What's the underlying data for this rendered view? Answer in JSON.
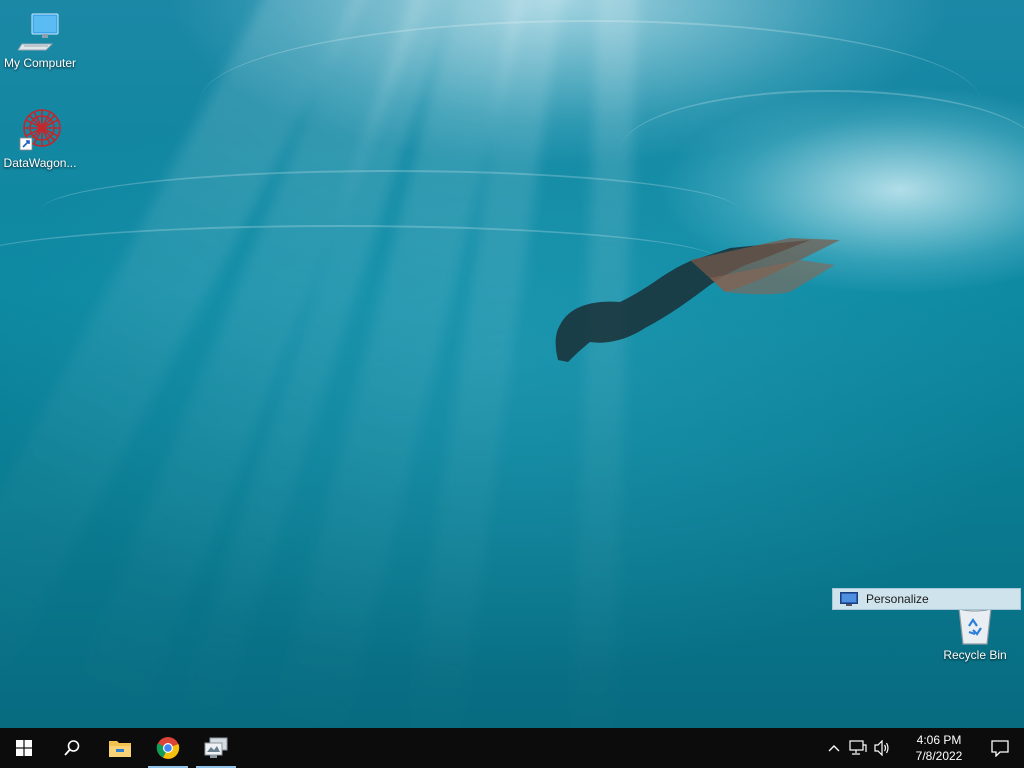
{
  "desktop": {
    "icons": [
      {
        "label": "My Computer",
        "icon": "computer-icon"
      },
      {
        "label": "DataWagon...",
        "icon": "datawagon-icon"
      },
      {
        "label": "Recycle Bin",
        "icon": "recycle-bin-icon"
      }
    ],
    "tooltip": {
      "label": "Personalize",
      "icon": "personalize-icon"
    }
  },
  "taskbar": {
    "pinned": [
      {
        "icon": "windows-start-icon"
      },
      {
        "icon": "search-icon"
      },
      {
        "icon": "file-explorer-icon"
      },
      {
        "icon": "chrome-icon"
      },
      {
        "icon": "remote-desktop-icon"
      }
    ],
    "tray": {
      "icons": [
        "chevron-up-icon",
        "network-icon",
        "volume-icon"
      ],
      "time": "4:06 PM",
      "date": "7/8/2022",
      "notification_icon": "action-center-icon"
    }
  },
  "colors": {
    "taskbar_bg": "#0c0c0c",
    "active_indicator": "#8fc4e8",
    "tooltip_bg": "#cfe3ec"
  }
}
